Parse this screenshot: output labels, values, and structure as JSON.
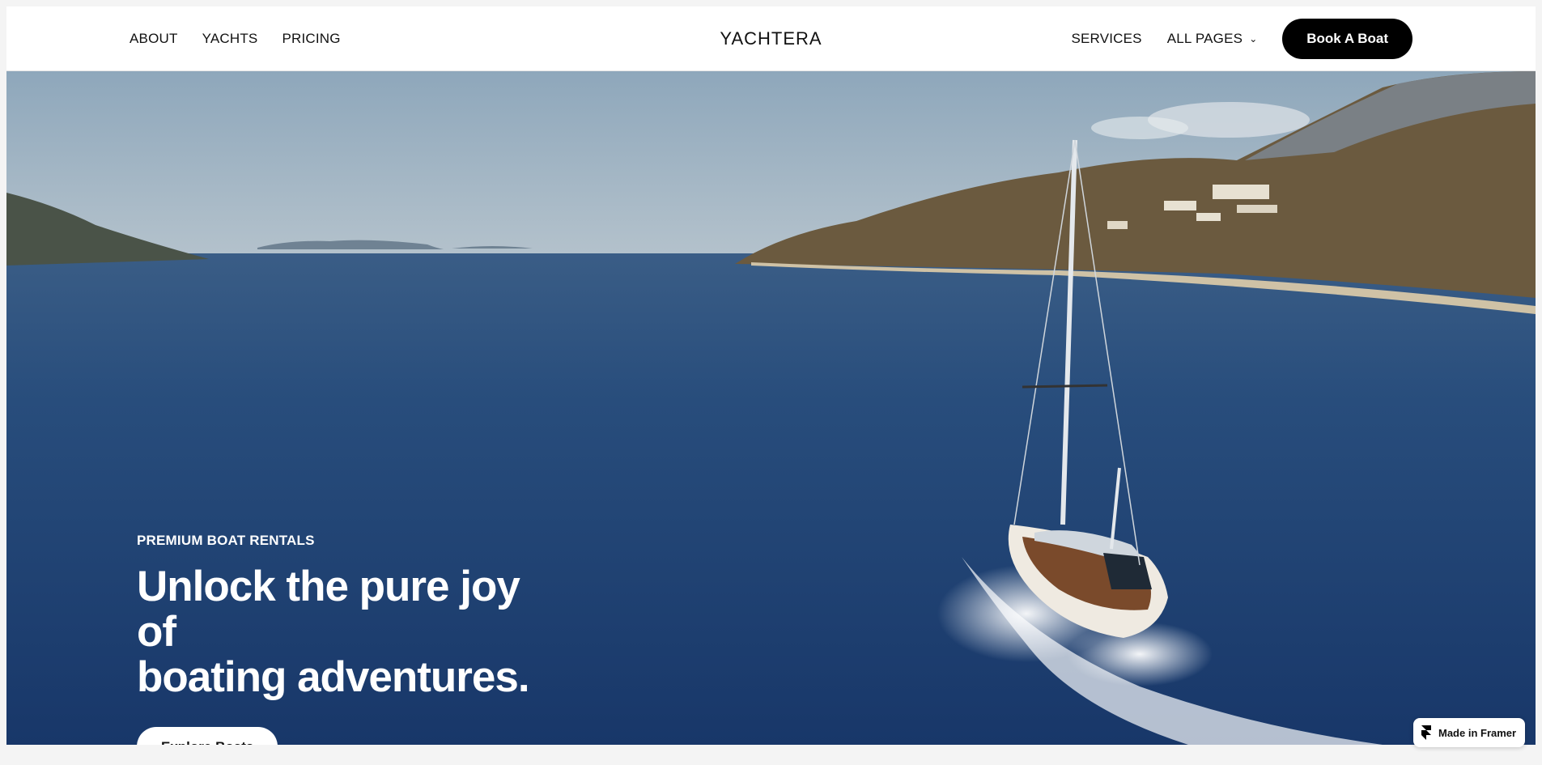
{
  "nav": {
    "left_links": [
      "ABOUT",
      "YACHTS",
      "PRICING"
    ],
    "logo": "YACHTERA",
    "services_label": "SERVICES",
    "all_pages_label": "ALL PAGES",
    "book_label": "Book A Boat"
  },
  "hero": {
    "eyebrow": "PREMIUM BOAT RENTALS",
    "headline_line1": "Unlock the pure joy of",
    "headline_line2": "boating adventures.",
    "cta_label": "Explore Boats",
    "image_alt": "sailing yacht on deep blue bay with hills"
  },
  "badge": {
    "label": "Made in Framer",
    "icon": "framer-logo-icon"
  },
  "colors": {
    "sea": "#1f3f6e",
    "sky": "#9fb3c3",
    "button_dark": "#000000",
    "button_light": "#ffffff"
  }
}
